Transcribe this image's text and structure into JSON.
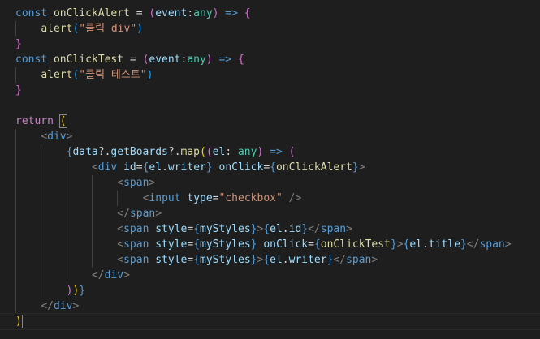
{
  "editor": {
    "lines": [
      {
        "indent": 0,
        "tokens": [
          {
            "t": "const ",
            "c": "k"
          },
          {
            "t": "onClickAlert",
            "c": "f"
          },
          {
            "t": " = ",
            "c": "p"
          },
          {
            "t": "(",
            "c": "b2"
          },
          {
            "t": "event",
            "c": "v"
          },
          {
            "t": ":",
            "c": "p"
          },
          {
            "t": "any",
            "c": "t"
          },
          {
            "t": ")",
            "c": "b2"
          },
          {
            "t": " => ",
            "c": "k"
          },
          {
            "t": "{",
            "c": "b2"
          }
        ]
      },
      {
        "indent": 1,
        "tokens": [
          {
            "t": "alert",
            "c": "f"
          },
          {
            "t": "(",
            "c": "b3"
          },
          {
            "t": "\"클릭 div\"",
            "c": "s"
          },
          {
            "t": ")",
            "c": "b3"
          }
        ]
      },
      {
        "indent": 0,
        "tokens": [
          {
            "t": "}",
            "c": "b2"
          }
        ]
      },
      {
        "indent": 0,
        "tokens": [
          {
            "t": "const ",
            "c": "k"
          },
          {
            "t": "onClickTest",
            "c": "f"
          },
          {
            "t": " = ",
            "c": "p"
          },
          {
            "t": "(",
            "c": "b2"
          },
          {
            "t": "event",
            "c": "v"
          },
          {
            "t": ":",
            "c": "p"
          },
          {
            "t": "any",
            "c": "t"
          },
          {
            "t": ")",
            "c": "b2"
          },
          {
            "t": " => ",
            "c": "k"
          },
          {
            "t": "{",
            "c": "b2"
          }
        ]
      },
      {
        "indent": 1,
        "tokens": [
          {
            "t": "alert",
            "c": "f"
          },
          {
            "t": "(",
            "c": "b3"
          },
          {
            "t": "\"클릭 테스트\"",
            "c": "s"
          },
          {
            "t": ")",
            "c": "b3"
          }
        ]
      },
      {
        "indent": 0,
        "tokens": [
          {
            "t": "}",
            "c": "b2"
          }
        ]
      },
      {
        "indent": 0,
        "tokens": []
      },
      {
        "indent": 0,
        "tokens": [
          {
            "t": "return ",
            "c": "c"
          },
          {
            "t": "(",
            "c": "b1",
            "cursor": true
          }
        ]
      },
      {
        "indent": 1,
        "tokens": [
          {
            "t": "<",
            "c": "ab"
          },
          {
            "t": "div",
            "c": "tg"
          },
          {
            "t": ">",
            "c": "ab"
          }
        ]
      },
      {
        "indent": 2,
        "tokens": [
          {
            "t": "{",
            "c": "k"
          },
          {
            "t": "data",
            "c": "v"
          },
          {
            "t": "?.",
            "c": "p"
          },
          {
            "t": "getBoards",
            "c": "v"
          },
          {
            "t": "?.",
            "c": "p"
          },
          {
            "t": "map",
            "c": "f"
          },
          {
            "t": "(",
            "c": "b1"
          },
          {
            "t": "(",
            "c": "b2"
          },
          {
            "t": "el",
            "c": "v"
          },
          {
            "t": ": ",
            "c": "p"
          },
          {
            "t": "any",
            "c": "t"
          },
          {
            "t": ")",
            "c": "b2"
          },
          {
            "t": " => ",
            "c": "k"
          },
          {
            "t": "(",
            "c": "b2"
          }
        ]
      },
      {
        "indent": 3,
        "tokens": [
          {
            "t": "<",
            "c": "ab"
          },
          {
            "t": "div",
            "c": "tg"
          },
          {
            "t": " ",
            "c": "p"
          },
          {
            "t": "id",
            "c": "at"
          },
          {
            "t": "=",
            "c": "p"
          },
          {
            "t": "{",
            "c": "k"
          },
          {
            "t": "el",
            "c": "v"
          },
          {
            "t": ".",
            "c": "p"
          },
          {
            "t": "writer",
            "c": "v"
          },
          {
            "t": "}",
            "c": "k"
          },
          {
            "t": " ",
            "c": "p"
          },
          {
            "t": "onClick",
            "c": "at"
          },
          {
            "t": "=",
            "c": "p"
          },
          {
            "t": "{",
            "c": "k"
          },
          {
            "t": "onClickAlert",
            "c": "f"
          },
          {
            "t": "}",
            "c": "k"
          },
          {
            "t": ">",
            "c": "ab"
          }
        ]
      },
      {
        "indent": 4,
        "tokens": [
          {
            "t": "<",
            "c": "ab"
          },
          {
            "t": "span",
            "c": "tg"
          },
          {
            "t": ">",
            "c": "ab"
          }
        ]
      },
      {
        "indent": 5,
        "tokens": [
          {
            "t": "<",
            "c": "ab"
          },
          {
            "t": "input",
            "c": "tg"
          },
          {
            "t": " ",
            "c": "p"
          },
          {
            "t": "type",
            "c": "at"
          },
          {
            "t": "=",
            "c": "p"
          },
          {
            "t": "\"checkbox\"",
            "c": "s"
          },
          {
            "t": " ",
            "c": "p"
          },
          {
            "t": "/>",
            "c": "ab"
          }
        ]
      },
      {
        "indent": 4,
        "tokens": [
          {
            "t": "</",
            "c": "ab"
          },
          {
            "t": "span",
            "c": "tg"
          },
          {
            "t": ">",
            "c": "ab"
          }
        ]
      },
      {
        "indent": 4,
        "tokens": [
          {
            "t": "<",
            "c": "ab"
          },
          {
            "t": "span",
            "c": "tg"
          },
          {
            "t": " ",
            "c": "p"
          },
          {
            "t": "style",
            "c": "at"
          },
          {
            "t": "=",
            "c": "p"
          },
          {
            "t": "{",
            "c": "k"
          },
          {
            "t": "myStyles",
            "c": "v"
          },
          {
            "t": "}",
            "c": "k"
          },
          {
            "t": ">",
            "c": "ab"
          },
          {
            "t": "{",
            "c": "k"
          },
          {
            "t": "el",
            "c": "v"
          },
          {
            "t": ".",
            "c": "p"
          },
          {
            "t": "id",
            "c": "v"
          },
          {
            "t": "}",
            "c": "k"
          },
          {
            "t": "</",
            "c": "ab"
          },
          {
            "t": "span",
            "c": "tg"
          },
          {
            "t": ">",
            "c": "ab"
          }
        ]
      },
      {
        "indent": 4,
        "tokens": [
          {
            "t": "<",
            "c": "ab"
          },
          {
            "t": "span",
            "c": "tg"
          },
          {
            "t": " ",
            "c": "p"
          },
          {
            "t": "style",
            "c": "at"
          },
          {
            "t": "=",
            "c": "p"
          },
          {
            "t": "{",
            "c": "k"
          },
          {
            "t": "myStyles",
            "c": "v"
          },
          {
            "t": "}",
            "c": "k"
          },
          {
            "t": " ",
            "c": "p"
          },
          {
            "t": "onClick",
            "c": "at"
          },
          {
            "t": "=",
            "c": "p"
          },
          {
            "t": "{",
            "c": "k"
          },
          {
            "t": "onClickTest",
            "c": "f"
          },
          {
            "t": "}",
            "c": "k"
          },
          {
            "t": ">",
            "c": "ab"
          },
          {
            "t": "{",
            "c": "k"
          },
          {
            "t": "el",
            "c": "v"
          },
          {
            "t": ".",
            "c": "p"
          },
          {
            "t": "title",
            "c": "v"
          },
          {
            "t": "}",
            "c": "k"
          },
          {
            "t": "</",
            "c": "ab"
          },
          {
            "t": "span",
            "c": "tg"
          },
          {
            "t": ">",
            "c": "ab"
          }
        ]
      },
      {
        "indent": 4,
        "tokens": [
          {
            "t": "<",
            "c": "ab"
          },
          {
            "t": "span",
            "c": "tg"
          },
          {
            "t": " ",
            "c": "p"
          },
          {
            "t": "style",
            "c": "at"
          },
          {
            "t": "=",
            "c": "p"
          },
          {
            "t": "{",
            "c": "k"
          },
          {
            "t": "myStyles",
            "c": "v"
          },
          {
            "t": "}",
            "c": "k"
          },
          {
            "t": ">",
            "c": "ab"
          },
          {
            "t": "{",
            "c": "k"
          },
          {
            "t": "el",
            "c": "v"
          },
          {
            "t": ".",
            "c": "p"
          },
          {
            "t": "writer",
            "c": "v"
          },
          {
            "t": "}",
            "c": "k"
          },
          {
            "t": "</",
            "c": "ab"
          },
          {
            "t": "span",
            "c": "tg"
          },
          {
            "t": ">",
            "c": "ab"
          }
        ]
      },
      {
        "indent": 3,
        "tokens": [
          {
            "t": "</",
            "c": "ab"
          },
          {
            "t": "div",
            "c": "tg"
          },
          {
            "t": ">",
            "c": "ab"
          }
        ]
      },
      {
        "indent": 2,
        "tokens": [
          {
            "t": ")",
            "c": "b2"
          },
          {
            "t": ")",
            "c": "b1"
          },
          {
            "t": "}",
            "c": "k"
          }
        ]
      },
      {
        "indent": 1,
        "tokens": [
          {
            "t": "</",
            "c": "ab"
          },
          {
            "t": "div",
            "c": "tg"
          },
          {
            "t": ">",
            "c": "ab"
          }
        ]
      },
      {
        "indent": 0,
        "current": true,
        "tokens": [
          {
            "t": ")",
            "c": "b1",
            "cursor": true
          }
        ]
      }
    ]
  }
}
